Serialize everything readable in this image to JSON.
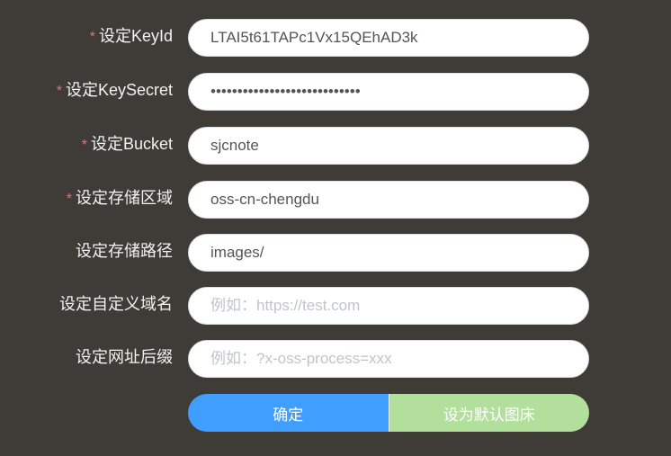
{
  "fields": [
    {
      "label": "设定KeyId",
      "required": true,
      "value": "LTAI5t61TAPc1Vx15QEhAD3k",
      "placeholder": "",
      "type": "text"
    },
    {
      "label": "设定KeySecret",
      "required": true,
      "value": "abcdefghijklmnopqrstuvwxyz12",
      "placeholder": "",
      "type": "password"
    },
    {
      "label": "设定Bucket",
      "required": true,
      "value": "sjcnote",
      "placeholder": "",
      "type": "text"
    },
    {
      "label": "设定存储区域",
      "required": true,
      "value": "oss-cn-chengdu",
      "placeholder": "",
      "type": "text"
    },
    {
      "label": "设定存储路径",
      "required": false,
      "value": "images/",
      "placeholder": "",
      "type": "text"
    },
    {
      "label": "设定自定义域名",
      "required": false,
      "value": "",
      "placeholder": "例如：https://test.com",
      "type": "text"
    },
    {
      "label": "设定网址后缀",
      "required": false,
      "value": "",
      "placeholder": "例如：?x-oss-process=xxx",
      "type": "text"
    }
  ],
  "required_mark": "*",
  "buttons": {
    "confirm": "确定",
    "set_default": "设为默认图床"
  }
}
